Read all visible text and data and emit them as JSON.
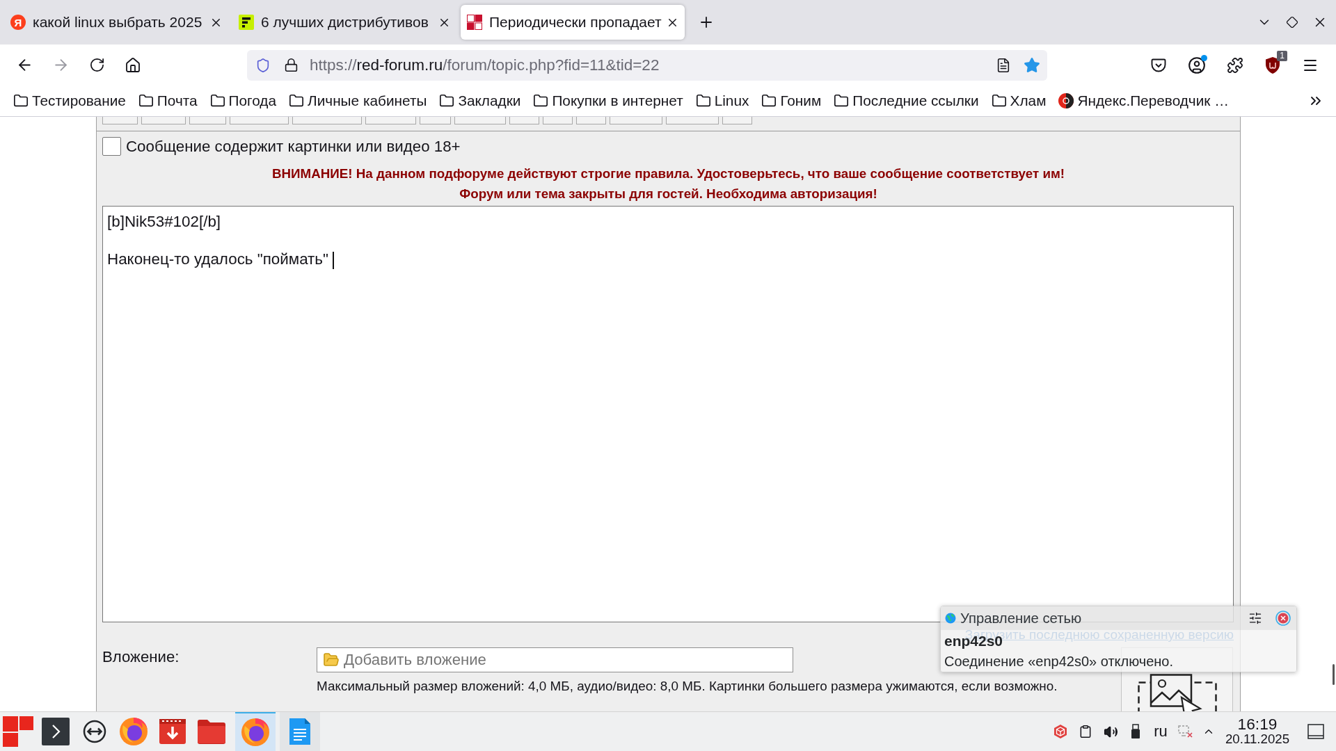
{
  "tabs": [
    {
      "kind": "letter",
      "icon_text": "Я",
      "title": "какой linux выбрать 2025",
      "selected": false
    },
    {
      "kind": "pixel",
      "title": "6 лучших дистрибутивов",
      "selected": false
    },
    {
      "kind": "blocks",
      "title": "Периодически пропадает",
      "selected": true
    }
  ],
  "address_bar": {
    "scheme": "https://",
    "host": "red-forum.ru",
    "path": "/forum/topic.php?fid=11&tid=22",
    "bookmarked": true
  },
  "toolbar": {
    "account_dot": true,
    "extension_badge": "1"
  },
  "bookmarks": [
    {
      "kind": "folder",
      "label": "Тестирование"
    },
    {
      "kind": "folder",
      "label": "Почта"
    },
    {
      "kind": "folder",
      "label": "Погода"
    },
    {
      "kind": "folder",
      "label": "Личные кабинеты"
    },
    {
      "kind": "folder",
      "label": "Закладки"
    },
    {
      "kind": "folder",
      "label": "Покупки в интернет"
    },
    {
      "kind": "folder",
      "label": "Linux"
    },
    {
      "kind": "folder",
      "label": "Гоним"
    },
    {
      "kind": "folder",
      "label": "Последние ссылки"
    },
    {
      "kind": "folder",
      "label": "Хлам"
    },
    {
      "kind": "site",
      "label": "Яндекс.Переводчик …"
    }
  ],
  "post_form": {
    "adult_content": {
      "label": "Сообщение содержит картинки или видео 18+",
      "checked": false
    },
    "warnings": [
      "ВНИМАНИЕ! На данном подфоруме действуют строгие правила. Удостоверьтесь, что ваше сообщение соответствует им!",
      "Форум или тема закрыты для гостей. Необходима авторизация!"
    ],
    "message": {
      "value": "[b]Nik53#102[/b]\n\nНаконец-то удалось \"поймать\" ",
      "focused": true
    },
    "restore_link": "Загрузить последнюю сохраненную версию",
    "attachment": {
      "label": "Вложение:",
      "button": "Добавить вложение",
      "note": "Максимальный размер вложений: 4,0 МБ, аудио/видео: 8,0 МБ. Картинки большего размера ужимаются, если возможно."
    }
  },
  "notification": {
    "app": "Управление сетью",
    "title": "enp42s0",
    "body": "Соединение «enp42s0» отключено."
  },
  "taskbar": {
    "apps": [
      {
        "kind": "terminal",
        "open": false,
        "selected": false
      },
      {
        "kind": "remote",
        "open": false,
        "selected": false
      },
      {
        "kind": "browser",
        "open": false,
        "selected": false
      },
      {
        "kind": "downloader",
        "open": false,
        "selected": false
      },
      {
        "kind": "files",
        "open": false,
        "selected": false
      },
      {
        "kind": "browser",
        "open": true,
        "selected": true
      },
      {
        "kind": "notes",
        "open": true,
        "selected": false
      }
    ],
    "tray": {
      "layout": "ru",
      "time": "16:19",
      "date": "20.11.2025"
    }
  }
}
